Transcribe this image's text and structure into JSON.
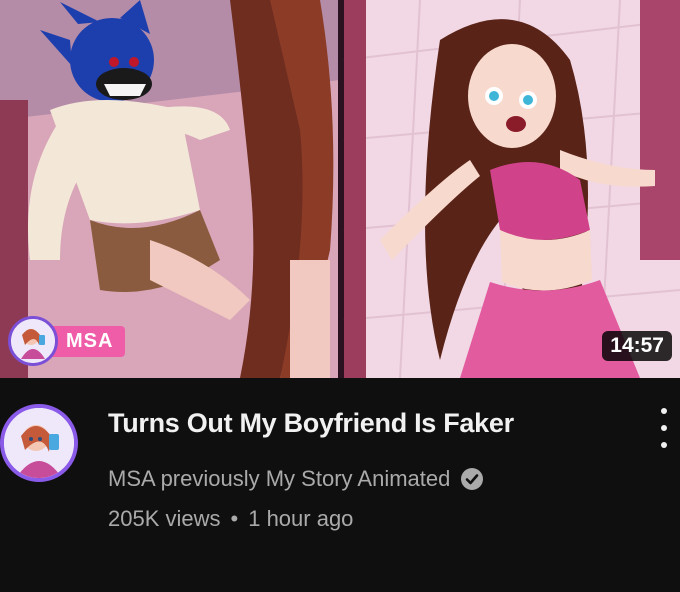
{
  "video": {
    "title": "Turns Out My Boyfriend Is Faker",
    "channel": "MSA previously My Story Animated",
    "views": "205K views",
    "separator": "•",
    "uploaded": "1 hour ago",
    "duration": "14:57",
    "verified_icon": "verified-check-icon"
  },
  "thumbnail": {
    "watermark": "MSA"
  },
  "colors": {
    "background": "#0f0f0f",
    "title": "#f1f1f1",
    "secondary": "#aaaaaa",
    "watermark_pink": "#ef5da8",
    "avatar_ring": "#8a5ae8"
  },
  "menu": {
    "icon": "more-vert-icon"
  }
}
